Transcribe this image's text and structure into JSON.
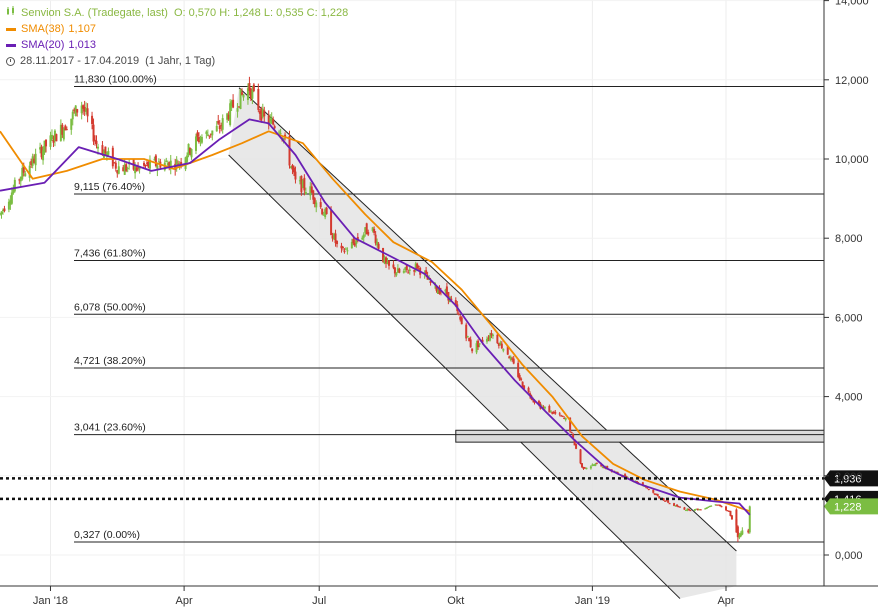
{
  "legend": {
    "title": "Senvion S.A. (Tradegate, last)",
    "ohlc": "O: 0,570  H: 1,248  L: 0,535  C: 1,228",
    "sma38_label": "SMA(38)",
    "sma38_value": "1,107",
    "sma20_label": "SMA(20)",
    "sma20_value": "1,013",
    "range": "28.11.2017 - 17.04.2019",
    "period": "(1 Jahr, 1 Tag)"
  },
  "colors": {
    "up": "#7bbd42",
    "down": "#d43a2f",
    "sma38": "#f08c00",
    "sma20": "#6a1fb4",
    "fib": "#222222",
    "channel_fill": "#e4e4e4",
    "marker_bg": "#111111"
  },
  "chart_data": {
    "type": "candlestick",
    "y_range": [
      -1.1,
      14.0
    ],
    "y_ticks": [
      {
        "value": 0,
        "label": "0,000"
      },
      {
        "value": 2,
        "label": "2,000"
      },
      {
        "value": 4,
        "label": "4,000"
      },
      {
        "value": 6,
        "label": "6,000"
      },
      {
        "value": 8,
        "label": "8,000"
      },
      {
        "value": 10,
        "label": "10,000"
      },
      {
        "value": 12,
        "label": "12,000"
      },
      {
        "value": 14,
        "label": "14,000"
      }
    ],
    "x_range": [
      "2017-11-28",
      "2019-06-06"
    ],
    "x_ticks": [
      {
        "date": "2018-01-01",
        "label": "Jan '18"
      },
      {
        "date": "2018-04-01",
        "label": "Apr"
      },
      {
        "date": "2018-07-01",
        "label": "Jul"
      },
      {
        "date": "2018-10-01",
        "label": "Okt"
      },
      {
        "date": "2019-01-01",
        "label": "Jan '19"
      },
      {
        "date": "2019-04-01",
        "label": "Apr"
      }
    ],
    "fibonacci": [
      {
        "value": 11.83,
        "label": "11,830 (100.00%)"
      },
      {
        "value": 9.115,
        "label": "9,115 (76.40%)"
      },
      {
        "value": 7.436,
        "label": "7,436 (61.80%)"
      },
      {
        "value": 6.078,
        "label": "6,078 (50.00%)"
      },
      {
        "value": 4.721,
        "label": "4,721 (38.20%)"
      },
      {
        "value": 3.041,
        "label": "3,041 (23.60%)"
      },
      {
        "value": 0.327,
        "label": "0,327 (0.00%)"
      }
    ],
    "resistance_zone": {
      "from": 2.85,
      "to": 3.15,
      "start": "2018-10-01"
    },
    "horizontal_levels": [
      {
        "value": 1.936,
        "label": "1,936"
      },
      {
        "value": 1.416,
        "label": "1,416"
      }
    ],
    "last_price": {
      "value": 1.228,
      "label": "1,228"
    },
    "channel": {
      "upper": [
        {
          "date": "2018-05-08",
          "value": 11.8
        },
        {
          "date": "2019-04-08",
          "value": 0.1
        }
      ],
      "lower": [
        {
          "date": "2018-05-01",
          "value": 10.1
        },
        {
          "date": "2019-03-01",
          "value": -1.1
        }
      ]
    },
    "price_path": [
      {
        "date": "2017-11-28",
        "value": 8.6
      },
      {
        "date": "2017-12-12",
        "value": 9.6
      },
      {
        "date": "2017-12-28",
        "value": 10.3
      },
      {
        "date": "2018-01-12",
        "value": 10.9
      },
      {
        "date": "2018-01-22",
        "value": 11.4
      },
      {
        "date": "2018-02-01",
        "value": 10.4
      },
      {
        "date": "2018-02-15",
        "value": 9.8
      },
      {
        "date": "2018-03-01",
        "value": 9.75
      },
      {
        "date": "2018-03-15",
        "value": 9.9
      },
      {
        "date": "2018-03-28",
        "value": 9.9
      },
      {
        "date": "2018-04-10",
        "value": 10.5
      },
      {
        "date": "2018-04-25",
        "value": 10.8
      },
      {
        "date": "2018-05-05",
        "value": 11.4
      },
      {
        "date": "2018-05-15",
        "value": 11.8
      },
      {
        "date": "2018-05-25",
        "value": 11.0
      },
      {
        "date": "2018-06-05",
        "value": 10.8
      },
      {
        "date": "2018-06-15",
        "value": 9.4
      },
      {
        "date": "2018-06-25",
        "value": 9.2
      },
      {
        "date": "2018-07-05",
        "value": 8.6
      },
      {
        "date": "2018-07-15",
        "value": 7.6
      },
      {
        "date": "2018-07-25",
        "value": 7.9
      },
      {
        "date": "2018-08-05",
        "value": 8.3
      },
      {
        "date": "2018-08-15",
        "value": 7.3
      },
      {
        "date": "2018-08-25",
        "value": 7.1
      },
      {
        "date": "2018-09-05",
        "value": 7.3
      },
      {
        "date": "2018-09-15",
        "value": 6.8
      },
      {
        "date": "2018-09-25",
        "value": 6.6
      },
      {
        "date": "2018-10-01",
        "value": 6.2
      },
      {
        "date": "2018-10-12",
        "value": 5.2
      },
      {
        "date": "2018-10-25",
        "value": 5.6
      },
      {
        "date": "2018-11-05",
        "value": 5.1
      },
      {
        "date": "2018-11-15",
        "value": 4.3
      },
      {
        "date": "2018-11-25",
        "value": 3.8
      },
      {
        "date": "2018-12-05",
        "value": 3.6
      },
      {
        "date": "2018-12-15",
        "value": 3.4
      },
      {
        "date": "2018-12-25",
        "value": 2.2
      },
      {
        "date": "2019-01-05",
        "value": 2.3
      },
      {
        "date": "2019-01-15",
        "value": 2.1
      },
      {
        "date": "2019-01-25",
        "value": 1.95
      },
      {
        "date": "2019-02-05",
        "value": 1.75
      },
      {
        "date": "2019-02-15",
        "value": 1.45
      },
      {
        "date": "2019-02-25",
        "value": 1.25
      },
      {
        "date": "2019-03-05",
        "value": 1.15
      },
      {
        "date": "2019-03-15",
        "value": 1.15
      },
      {
        "date": "2019-03-25",
        "value": 1.3
      },
      {
        "date": "2019-04-03",
        "value": 1.1
      },
      {
        "date": "2019-04-09",
        "value": 0.45
      },
      {
        "date": "2019-04-12",
        "value": 0.55
      },
      {
        "date": "2019-04-17",
        "value": 1.228
      }
    ],
    "sma38": [
      {
        "date": "2017-11-28",
        "value": 10.7
      },
      {
        "date": "2017-12-20",
        "value": 9.5
      },
      {
        "date": "2018-01-12",
        "value": 9.7
      },
      {
        "date": "2018-02-05",
        "value": 10.0
      },
      {
        "date": "2018-03-05",
        "value": 10.0
      },
      {
        "date": "2018-03-25",
        "value": 9.75
      },
      {
        "date": "2018-04-20",
        "value": 10.1
      },
      {
        "date": "2018-05-10",
        "value": 10.4
      },
      {
        "date": "2018-05-28",
        "value": 10.7
      },
      {
        "date": "2018-06-20",
        "value": 10.4
      },
      {
        "date": "2018-07-10",
        "value": 9.5
      },
      {
        "date": "2018-08-01",
        "value": 8.6
      },
      {
        "date": "2018-08-20",
        "value": 7.9
      },
      {
        "date": "2018-09-15",
        "value": 7.4
      },
      {
        "date": "2018-10-05",
        "value": 6.7
      },
      {
        "date": "2018-10-25",
        "value": 5.8
      },
      {
        "date": "2018-11-15",
        "value": 4.8
      },
      {
        "date": "2018-12-05",
        "value": 4.0
      },
      {
        "date": "2018-12-25",
        "value": 3.0
      },
      {
        "date": "2019-01-15",
        "value": 2.3
      },
      {
        "date": "2019-02-05",
        "value": 1.9
      },
      {
        "date": "2019-03-01",
        "value": 1.6
      },
      {
        "date": "2019-03-25",
        "value": 1.4
      },
      {
        "date": "2019-04-17",
        "value": 1.107
      }
    ],
    "sma20": [
      {
        "date": "2017-11-28",
        "value": 9.2
      },
      {
        "date": "2017-12-28",
        "value": 9.4
      },
      {
        "date": "2018-01-20",
        "value": 10.3
      },
      {
        "date": "2018-02-15",
        "value": 10.0
      },
      {
        "date": "2018-03-10",
        "value": 9.7
      },
      {
        "date": "2018-04-05",
        "value": 9.9
      },
      {
        "date": "2018-04-25",
        "value": 10.5
      },
      {
        "date": "2018-05-15",
        "value": 11.0
      },
      {
        "date": "2018-05-28",
        "value": 10.9
      },
      {
        "date": "2018-06-15",
        "value": 10.1
      },
      {
        "date": "2018-07-05",
        "value": 8.9
      },
      {
        "date": "2018-07-25",
        "value": 8.0
      },
      {
        "date": "2018-08-15",
        "value": 7.6
      },
      {
        "date": "2018-09-10",
        "value": 7.1
      },
      {
        "date": "2018-10-01",
        "value": 6.3
      },
      {
        "date": "2018-10-20",
        "value": 5.3
      },
      {
        "date": "2018-11-10",
        "value": 4.4
      },
      {
        "date": "2018-12-01",
        "value": 3.6
      },
      {
        "date": "2018-12-20",
        "value": 2.9
      },
      {
        "date": "2019-01-10",
        "value": 2.2
      },
      {
        "date": "2019-02-01",
        "value": 1.8
      },
      {
        "date": "2019-03-01",
        "value": 1.45
      },
      {
        "date": "2019-03-25",
        "value": 1.35
      },
      {
        "date": "2019-04-10",
        "value": 1.3
      },
      {
        "date": "2019-04-17",
        "value": 1.013
      }
    ]
  }
}
